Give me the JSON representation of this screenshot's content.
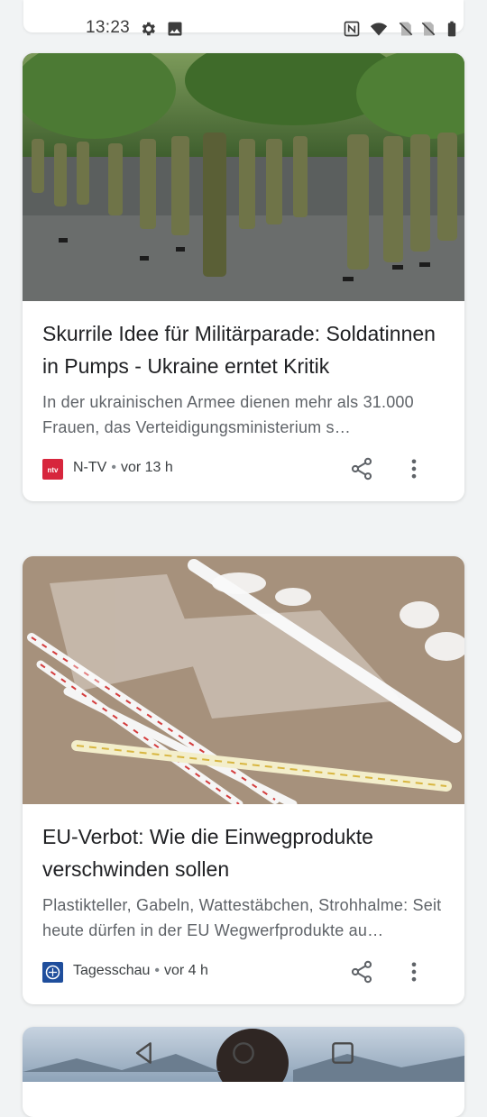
{
  "status_bar": {
    "time": "13:23",
    "icons": [
      "gear-icon",
      "image-icon",
      "nfc-icon",
      "wifi-icon",
      "no-sim-icon",
      "no-sim-icon",
      "battery-icon"
    ]
  },
  "articles": [
    {
      "image": "soldiers-marching-in-heels",
      "headline": "Skurrile Idee für Militärparade: Soldatinnen in Pumps - Ukraine erntet Kritik",
      "snippet": "In der ukrainischen Armee dienen mehr als 31.000 Frauen, das Verteidigungsministerium s…",
      "source": "N-TV",
      "time": "vor 13 h",
      "logo_color": "#d7263d"
    },
    {
      "image": "plastic-cutlery-and-straws",
      "headline": "EU-Verbot: Wie die Einwegprodukte verschwinden sollen",
      "snippet": "Plastikteller, Gabeln, Wattestäbchen, Strohhalme: Seit heute dürfen in der EU Wegwerfprodukte au…",
      "source": "Tagesschau",
      "time": "vor 4 h",
      "logo_color": "#1f4e9c"
    }
  ],
  "nav": {
    "buttons": [
      "back-icon",
      "home-icon",
      "recents-icon"
    ]
  }
}
